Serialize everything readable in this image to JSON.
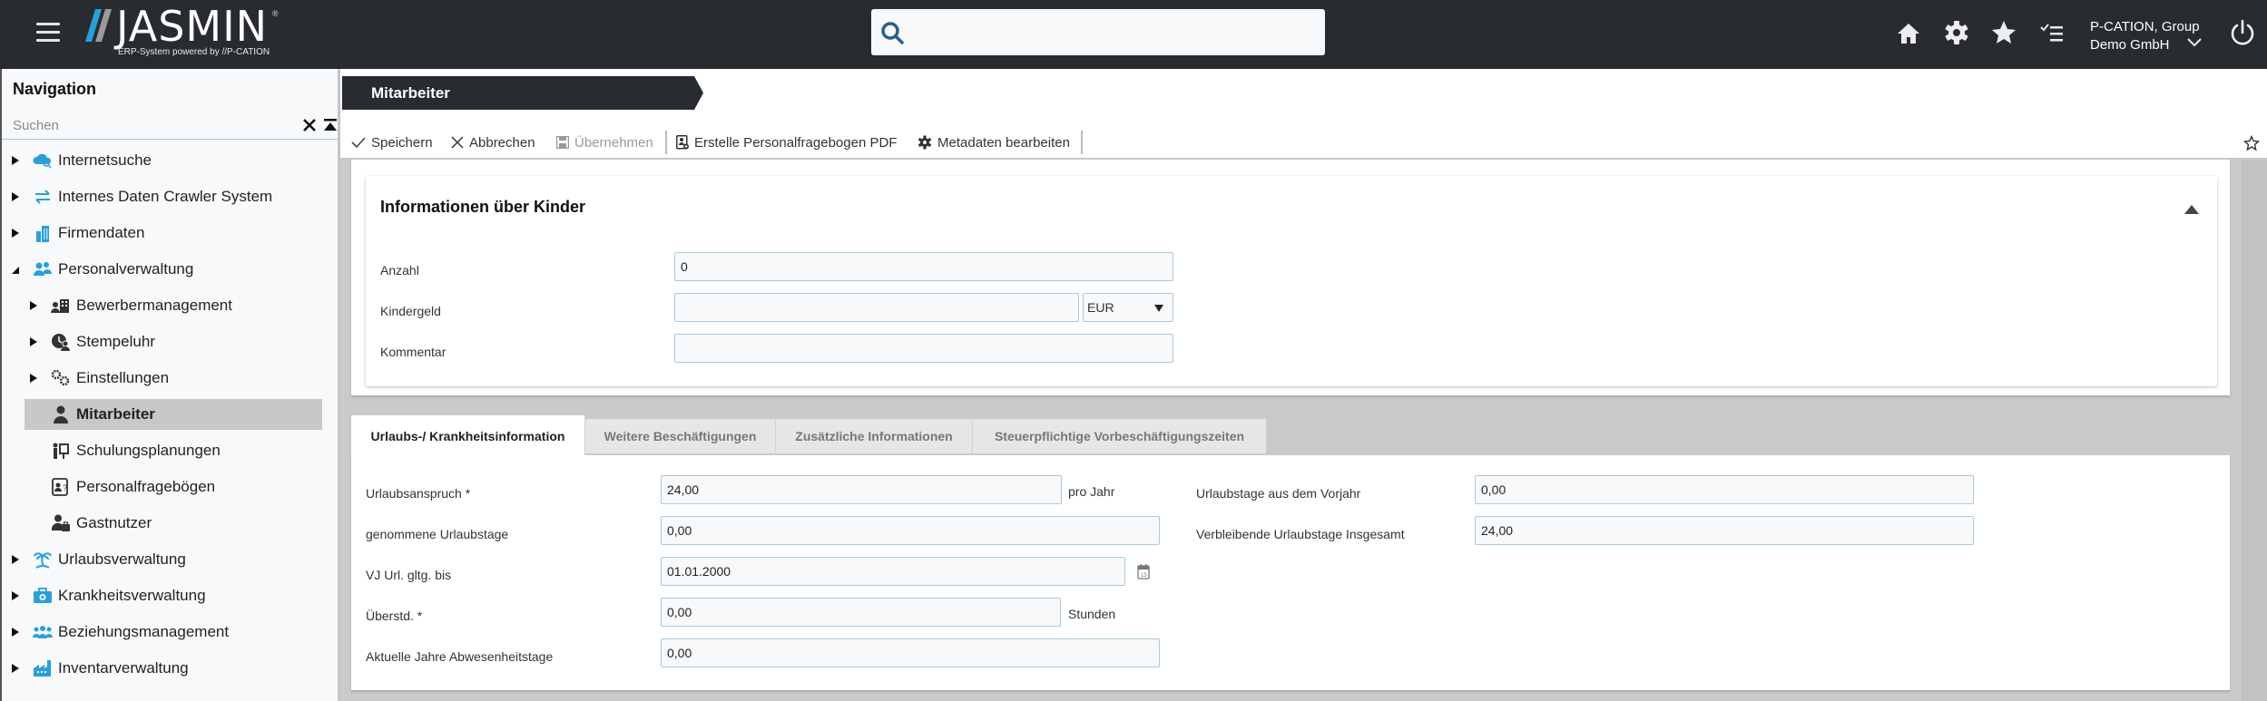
{
  "header": {
    "logo_text": "JASMIN",
    "logo_registered": "®",
    "logo_subtitle": "ERP-System powered by //P-CATION",
    "search": {
      "placeholder": "",
      "value": ""
    },
    "icons": [
      "home-icon",
      "gear-icon",
      "star-icon",
      "checklist-icon"
    ],
    "user": {
      "line1": "P-CATION, Group",
      "line2": "Demo GmbH"
    }
  },
  "sidebar": {
    "title": "Navigation",
    "search_placeholder": "Suchen",
    "items": [
      {
        "label": "Internetsuche",
        "level": 0,
        "expander": "collapsed",
        "icon": "cloud-search-icon"
      },
      {
        "label": "Internes Daten Crawler System",
        "level": 0,
        "expander": "collapsed",
        "icon": "sync-arrows-icon"
      },
      {
        "label": "Firmendaten",
        "level": 0,
        "expander": "collapsed",
        "icon": "building-icon"
      },
      {
        "label": "Personalverwaltung",
        "level": 0,
        "expander": "expanded",
        "icon": "people-icon"
      },
      {
        "label": "Bewerbermanagement",
        "level": 1,
        "expander": "collapsed",
        "icon": "applicant-icon"
      },
      {
        "label": "Stempeluhr",
        "level": 1,
        "expander": "collapsed",
        "icon": "time-clock-icon"
      },
      {
        "label": "Einstellungen",
        "level": 1,
        "expander": "collapsed",
        "icon": "gears-icon"
      },
      {
        "label": "Mitarbeiter",
        "level": 1,
        "expander": "none",
        "icon": "person-icon",
        "active": true
      },
      {
        "label": "Schulungsplanungen",
        "level": 1,
        "expander": "none",
        "icon": "presentation-icon"
      },
      {
        "label": "Personalfragebögen",
        "level": 1,
        "expander": "none",
        "icon": "questionnaire-icon"
      },
      {
        "label": "Gastnutzer",
        "level": 1,
        "expander": "none",
        "icon": "guest-user-icon"
      },
      {
        "label": "Urlaubsverwaltung",
        "level": 0,
        "expander": "collapsed",
        "icon": "palm-tree-icon"
      },
      {
        "label": "Krankheitsverwaltung",
        "level": 0,
        "expander": "collapsed",
        "icon": "medical-bag-icon"
      },
      {
        "label": "Beziehungsmanagement",
        "level": 0,
        "expander": "collapsed",
        "icon": "group-icon"
      },
      {
        "label": "Inventarverwaltung",
        "level": 0,
        "expander": "collapsed",
        "icon": "factory-icon"
      }
    ]
  },
  "main": {
    "breadcrumb": "Mitarbeiter",
    "toolbar": {
      "save": "Speichern",
      "cancel": "Abbrechen",
      "apply": "Übernehmen",
      "create_pdf": "Erstelle Personalfragebogen PDF",
      "edit_metadata": "Metadaten bearbeiten"
    },
    "children_section": {
      "title": "Informationen über Kinder",
      "fields": {
        "anzahl": {
          "label": "Anzahl",
          "value": "0"
        },
        "kindergeld": {
          "label": "Kindergeld",
          "value": "",
          "currency": "EUR"
        },
        "kommentar": {
          "label": "Kommentar",
          "value": ""
        }
      }
    },
    "tabs": [
      {
        "label": "Urlaubs-/ Krankheitsinformation",
        "active": true
      },
      {
        "label": "Weitere Beschäftigungen",
        "active": false
      },
      {
        "label": "Zusätzliche Informationen",
        "active": false
      },
      {
        "label": "Steuerpflichtige Vorbeschäftigungszeiten",
        "active": false
      }
    ],
    "vacation": {
      "urlaubsanspruch": {
        "label": "Urlaubsanspruch *",
        "value": "24,00",
        "suffix": "pro Jahr"
      },
      "genommene": {
        "label": "genommene Urlaubstage",
        "value": "0,00"
      },
      "vj_gueltig": {
        "label": "VJ Url. gltg. bis",
        "value": "01.01.2000"
      },
      "ueberstunden": {
        "label": "Überstd. *",
        "value": "0,00",
        "suffix": "Stunden"
      },
      "abwesenheit": {
        "label": "Aktuelle Jahre Abwesenheitstage",
        "value": "0,00"
      },
      "vorjahr": {
        "label": "Urlaubstage aus dem Vorjahr",
        "value": "0,00"
      },
      "verbleibend": {
        "label": "Verbleibende Urlaubstage Insgesamt",
        "value": "24,00"
      }
    }
  },
  "colors": {
    "topbar": "#282c30",
    "accent_blue": "#2a9fd8",
    "logo_grey": "#9a9a9a",
    "search_icon": "#2f5d8a",
    "input_border": "#a9cadc",
    "active_nav": "#c8c8c8"
  }
}
